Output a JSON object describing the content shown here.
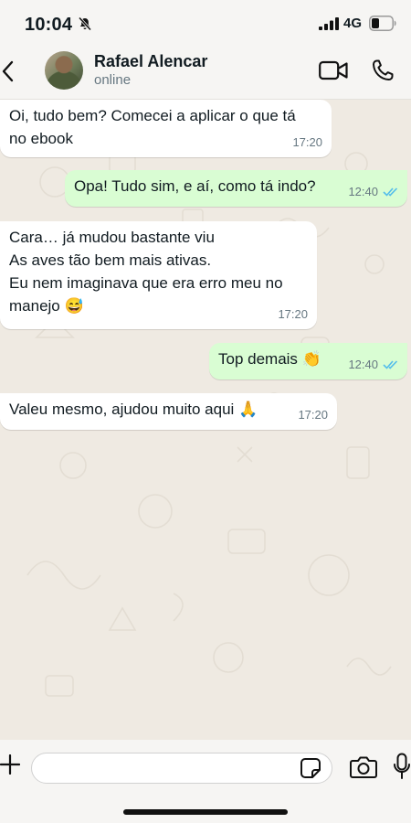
{
  "status_bar": {
    "time": "10:04",
    "network": "4G",
    "icons": [
      "mute-icon",
      "signal-icon",
      "battery-icon"
    ]
  },
  "header": {
    "contact_name": "Rafael Alencar",
    "contact_status": "online",
    "icons": [
      "back-icon",
      "avatar",
      "video-call-icon",
      "voice-call-icon"
    ]
  },
  "messages": [
    {
      "direction": "incoming",
      "text": "Oi, tudo bem? Comecei a aplicar o que tá\nno ebook",
      "time": "17:20",
      "read": false
    },
    {
      "direction": "outgoing",
      "text": "Opa! Tudo sim, e aí, como tá indo?",
      "time": "12:40",
      "read": true
    },
    {
      "direction": "incoming",
      "text": "Cara… já mudou bastante viu\nAs aves tão bem mais ativas.\nEu nem imaginava que era erro meu no\nmanejo 😅",
      "time": "17:20",
      "read": false
    },
    {
      "direction": "outgoing",
      "text": "Top demais 👏",
      "time": "12:40",
      "read": true
    },
    {
      "direction": "incoming",
      "text": "Valeu mesmo, ajudou muito aqui 🙏",
      "time": "17:20",
      "read": false
    }
  ],
  "input_bar": {
    "placeholder": "",
    "icons": [
      "plus-icon",
      "sticker-icon",
      "camera-icon",
      "mic-icon"
    ]
  },
  "colors": {
    "background": "#efeae2",
    "incoming_bubble": "#ffffff",
    "outgoing_bubble": "#d9fdd3",
    "read_tick": "#53bdeb",
    "timestamp": "#667781"
  }
}
